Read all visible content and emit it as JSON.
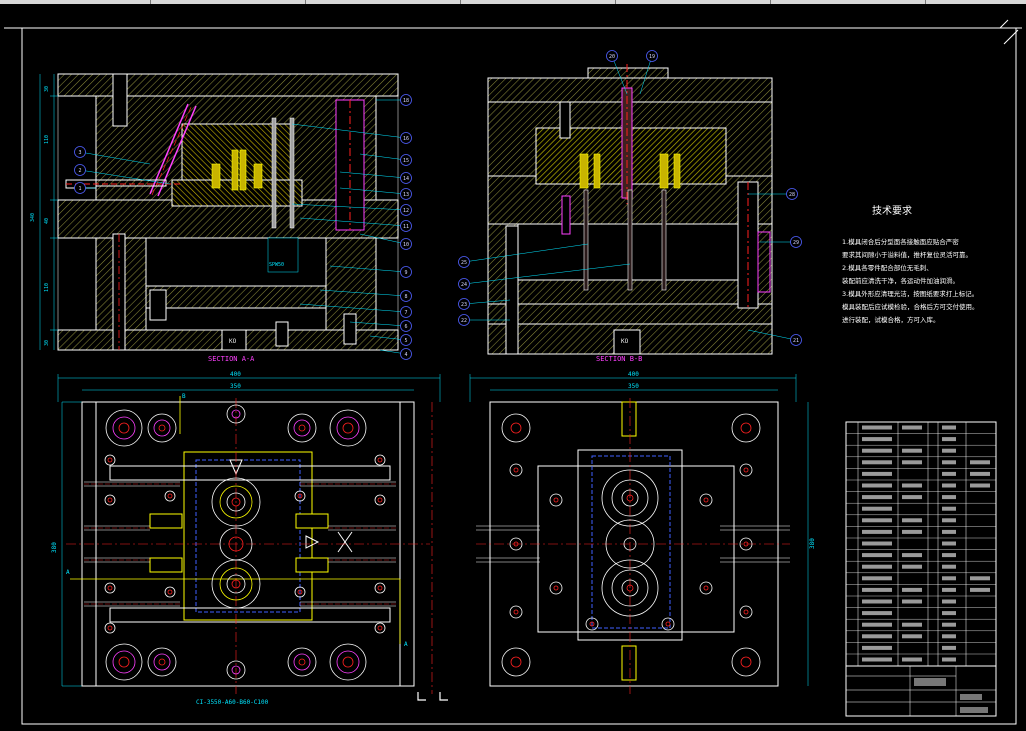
{
  "viewer": {
    "background": "#000000",
    "tab_strip": "#d8d8d8"
  },
  "views": {
    "section_a": {
      "caption": "SECTION A-A",
      "label_ko": "KO",
      "dim_total": "340"
    },
    "section_b": {
      "caption": "SECTION B-B",
      "label_ko": "KO"
    },
    "plan_left": {
      "dim_width": "400",
      "dim_inner": "350",
      "dim_height": "380",
      "cut_a": "A",
      "cut_b": "B",
      "part_code": "CI-3550-A60-B60-C100"
    },
    "plan_right": {
      "dim_width": "400",
      "dim_inner": "350",
      "dim_height": "380"
    }
  },
  "balloons_a": [
    "18",
    "16",
    "15",
    "14",
    "13",
    "12",
    "11",
    "10",
    "9",
    "8",
    "7",
    "6",
    "5",
    "4",
    "3",
    "2",
    "1"
  ],
  "balloons_b": [
    "20",
    "19",
    "28",
    "29",
    "25",
    "24",
    "23",
    "22",
    "21"
  ],
  "tech_req": {
    "title": "技术要求",
    "lines": [
      "1.模具闭合后分型面各接触面应贴合严密",
      "要求其间隙小于溢料值，推杆复位灵活可靠。",
      "2.模具各零件配合部位无毛刺、",
      "装配前应清洗干净，各运动件加油润滑。",
      "3.模具外形应清理光洁，按图纸要求打上标记。",
      "模具装配后应试模检验，合格后方可交付使用。",
      "进行装配，试模合格，方可入库。"
    ]
  },
  "colors": {
    "yellow": "#ffff00",
    "cyan": "#00e5ff",
    "green": "#00ff00",
    "red": "#ff2020",
    "magenta": "#ff40ff",
    "blue": "#4060ff",
    "white": "#ffffff"
  }
}
